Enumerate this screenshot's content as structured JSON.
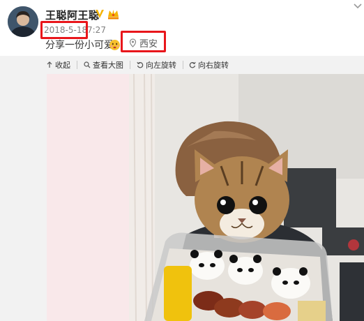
{
  "user": {
    "name": "王聪阿王聪"
  },
  "post": {
    "date": "2018-5-18",
    "time": "7:27",
    "text": "分享一份小可爱",
    "location": "西安"
  },
  "toolbar": {
    "collapse": "收起",
    "view_large": "查看大图",
    "rotate_left": "向左旋转",
    "rotate_right": "向右旋转"
  },
  "colors": {
    "highlight_red": "#e8161b",
    "vip_gold": "#f5b301",
    "toolbar_bg": "#f2f2f2"
  },
  "icons": [
    "avatar",
    "vip-icon",
    "crown-icon",
    "chevron-down-icon",
    "emoji-icon",
    "location-pin-icon",
    "collapse-icon",
    "search-icon",
    "rotate-left-icon",
    "rotate-right-icon"
  ]
}
